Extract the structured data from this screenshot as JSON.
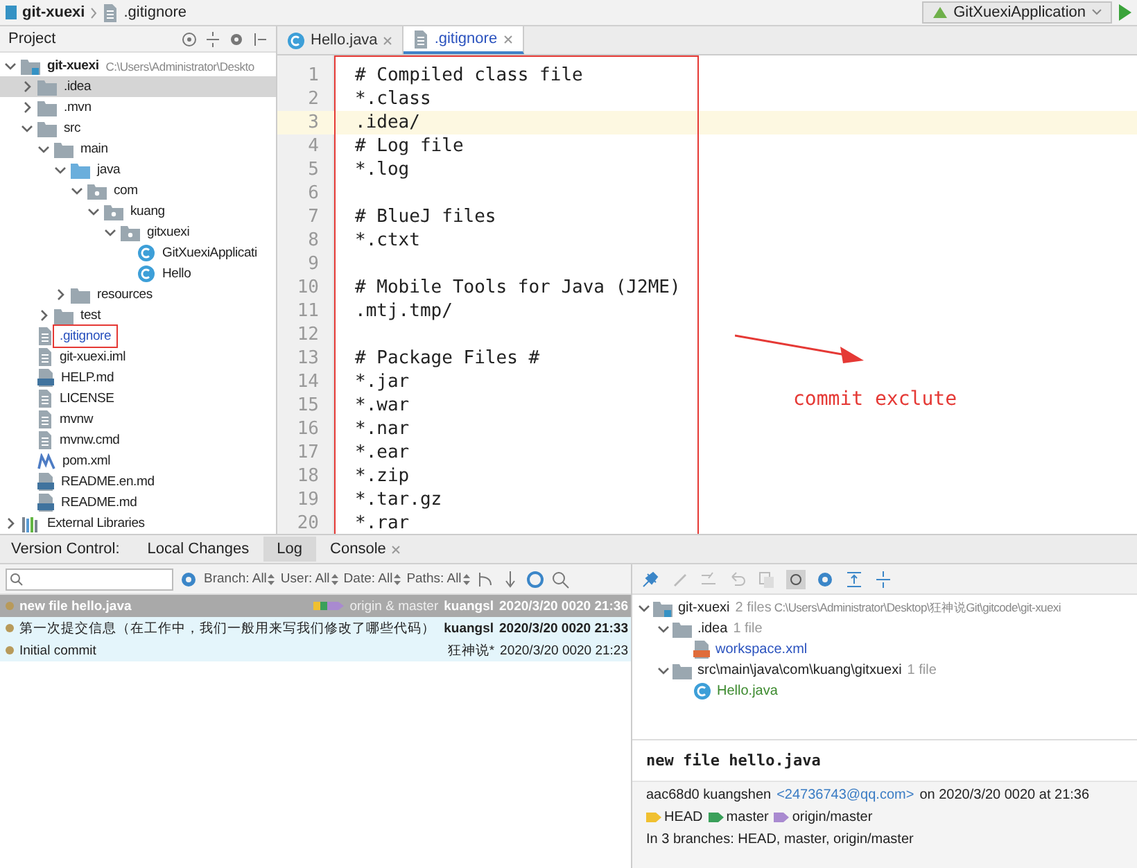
{
  "navbar": {
    "breadcrumbs": [
      "git-xuexi",
      ".gitignore"
    ],
    "run_config": "GitXuexiApplication"
  },
  "project_panel": {
    "title": "Project",
    "tree": [
      {
        "label": "git-xuexi",
        "kind": "module",
        "hint": "C:\\Users\\Administrator\\Deskto",
        "expanded": true,
        "selected": false,
        "marked": false,
        "children": [
          {
            "label": ".idea",
            "kind": "folder",
            "expanded": false,
            "selected": true,
            "marked": false
          },
          {
            "label": ".mvn",
            "kind": "folder",
            "expanded": false,
            "selected": false,
            "marked": false
          },
          {
            "label": "src",
            "kind": "folder",
            "expanded": true,
            "selected": false,
            "marked": false,
            "children": [
              {
                "label": "main",
                "kind": "folder",
                "expanded": true,
                "selected": false,
                "marked": false,
                "children": [
                  {
                    "label": "java",
                    "kind": "source-folder",
                    "expanded": true,
                    "selected": false,
                    "marked": false,
                    "children": [
                      {
                        "label": "com",
                        "kind": "package",
                        "expanded": true,
                        "selected": false,
                        "marked": false,
                        "children": [
                          {
                            "label": "kuang",
                            "kind": "package",
                            "expanded": true,
                            "selected": false,
                            "marked": false,
                            "children": [
                              {
                                "label": "gitxuexi",
                                "kind": "package",
                                "expanded": true,
                                "selected": false,
                                "marked": false,
                                "children": [
                                  {
                                    "label": "GitXuexiApplicati",
                                    "kind": "java-class",
                                    "selected": false,
                                    "marked": false
                                  },
                                  {
                                    "label": "Hello",
                                    "kind": "java-class",
                                    "selected": false,
                                    "marked": false
                                  }
                                ]
                              }
                            ]
                          }
                        ]
                      }
                    ]
                  },
                  {
                    "label": "resources",
                    "kind": "folder",
                    "expanded": false,
                    "selected": false,
                    "marked": false
                  }
                ]
              },
              {
                "label": "test",
                "kind": "folder",
                "expanded": false,
                "selected": false,
                "marked": false
              }
            ]
          },
          {
            "label": ".gitignore",
            "kind": "file",
            "selected": false,
            "marked": true
          },
          {
            "label": "git-xuexi.iml",
            "kind": "file",
            "selected": false,
            "marked": false
          },
          {
            "label": "HELP.md",
            "kind": "markdown",
            "selected": false,
            "marked": false
          },
          {
            "label": "LICENSE",
            "kind": "file",
            "selected": false,
            "marked": false
          },
          {
            "label": "mvnw",
            "kind": "file",
            "selected": false,
            "marked": false
          },
          {
            "label": "mvnw.cmd",
            "kind": "file",
            "selected": false,
            "marked": false
          },
          {
            "label": "pom.xml",
            "kind": "maven",
            "selected": false,
            "marked": false
          },
          {
            "label": "README.en.md",
            "kind": "markdown",
            "selected": false,
            "marked": false
          },
          {
            "label": "README.md",
            "kind": "markdown",
            "selected": false,
            "marked": false
          }
        ]
      },
      {
        "label": "External Libraries",
        "kind": "library",
        "expanded": false,
        "selected": false,
        "marked": false
      }
    ]
  },
  "editor": {
    "tabs": [
      {
        "label": "Hello.java",
        "kind": "java",
        "selected": false
      },
      {
        "label": ".gitignore",
        "kind": "file",
        "selected": true
      }
    ],
    "marked": true,
    "lines": [
      {
        "number": "1",
        "text": "# Compiled class file",
        "current": false
      },
      {
        "number": "2",
        "text": "*.class",
        "current": false
      },
      {
        "number": "3",
        "text": ".idea/",
        "current": true
      },
      {
        "number": "4",
        "text": "# Log file",
        "current": false
      },
      {
        "number": "5",
        "text": "*.log",
        "current": false
      },
      {
        "number": "6",
        "current": false
      },
      {
        "number": "7",
        "text": "# BlueJ files",
        "current": false
      },
      {
        "number": "8",
        "text": "*.ctxt",
        "current": false
      },
      {
        "number": "9",
        "current": false
      },
      {
        "number": "10",
        "text": "# Mobile Tools for Java (J2ME)",
        "current": false
      },
      {
        "number": "11",
        "text": ".mtj.tmp/",
        "current": false
      },
      {
        "number": "12",
        "current": false
      },
      {
        "number": "13",
        "text": "# Package Files #",
        "current": false
      },
      {
        "number": "14",
        "text": "*.jar",
        "current": false
      },
      {
        "number": "15",
        "text": "*.war",
        "current": false
      },
      {
        "number": "16",
        "text": "*.nar",
        "current": false
      },
      {
        "number": "17",
        "text": "*.ear",
        "current": false
      },
      {
        "number": "18",
        "text": "*.zip",
        "current": false
      },
      {
        "number": "19",
        "text": "*.tar.gz",
        "current": false
      },
      {
        "number": "20",
        "text": "*.rar",
        "current": false
      }
    ],
    "annotation": "commit exclute"
  },
  "version_control": {
    "title": "Version Control:",
    "tabs": [
      {
        "label": "Local Changes",
        "selected": false,
        "closable": false
      },
      {
        "label": "Log",
        "selected": true,
        "closable": false
      },
      {
        "label": "Console",
        "selected": false,
        "closable": true
      }
    ],
    "filters": [
      "Branch: All",
      "User: All",
      "Date: All",
      "Paths: All"
    ],
    "commits": [
      {
        "message": "new file hello.java",
        "refs": "origin & master",
        "author": "kuangsl",
        "date": "2020/3/20 0020 21:36",
        "selected": true,
        "bold": true,
        "highlighted": false
      },
      {
        "message": "第一次提交信息（在工作中，我们一般用来写我们修改了哪些代码）",
        "author": "kuangsl",
        "date": "2020/3/20 0020 21:33",
        "selected": false,
        "bold": true,
        "highlighted": true
      },
      {
        "message": "Initial commit",
        "author": "狂神说*",
        "date": "2020/3/20 0020 21:23",
        "selected": false,
        "bold": false,
        "highlighted": true
      }
    ],
    "changes": {
      "root": "git-xuexi",
      "root_count": "2 files",
      "root_path": "C:\\Users\\Administrator\\Desktop\\狂神说Git\\gitcode\\git-xuexi",
      "groups": [
        {
          "label": ".idea",
          "count": "1 file",
          "files": [
            {
              "name": "workspace.xml",
              "kind": "xml",
              "color": "#2a52be"
            }
          ]
        },
        {
          "label": "src\\main\\java\\com\\kuang\\gitxuexi",
          "count": "1 file",
          "files": [
            {
              "name": "Hello.java",
              "kind": "java",
              "color": "#3c8a2e"
            }
          ]
        }
      ]
    },
    "details": {
      "subject": "new file hello.java",
      "hash_author": "aac68d0 kuangshen",
      "email": "<24736743@qq.com>",
      "when": "on 2020/3/20 0020 at 21:36",
      "tags": [
        {
          "label": "HEAD",
          "color": "#f0c030"
        },
        {
          "label": "master",
          "color": "#3aa05a"
        },
        {
          "label": "origin/master",
          "color": "#a98ad0"
        }
      ],
      "branches": "In 3 branches: HEAD, master, origin/master"
    }
  }
}
